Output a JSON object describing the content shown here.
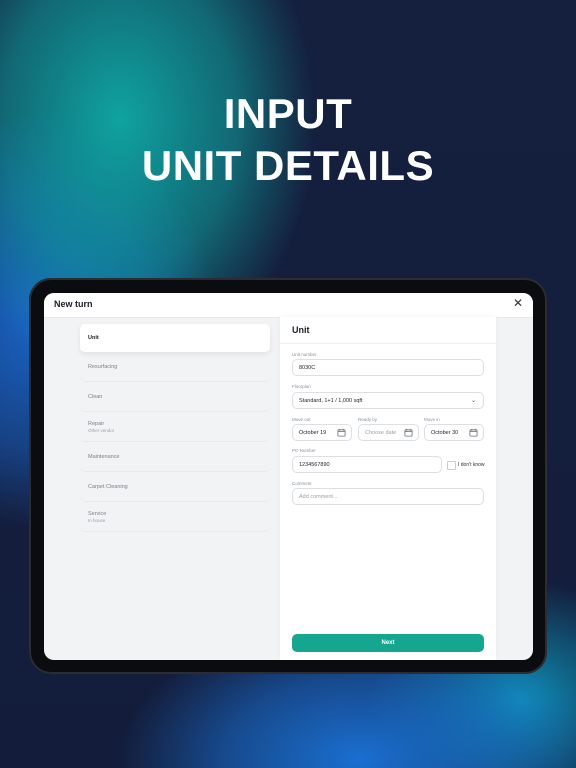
{
  "headline": {
    "line1": "INPUT",
    "line2": "UNIT DETAILS"
  },
  "modal": {
    "title": "New turn",
    "close_icon": "close-icon"
  },
  "sidebar": {
    "items": [
      {
        "label": "Unit",
        "sub": ""
      },
      {
        "label": "Resurfacing",
        "sub": ""
      },
      {
        "label": "Clean",
        "sub": ""
      },
      {
        "label": "Repair",
        "sub": "Other vendor"
      },
      {
        "label": "Maintenance",
        "sub": ""
      },
      {
        "label": "Carpet Cleaning",
        "sub": ""
      },
      {
        "label": "Service",
        "sub": "In house"
      }
    ]
  },
  "form": {
    "title": "Unit",
    "unit_number": {
      "label": "Unit number",
      "value": "8030C"
    },
    "floorplan": {
      "label": "Floorplan",
      "value": "Standard, 1+1 / 1,000 sqft"
    },
    "move_out": {
      "label": "Move out",
      "value": "October 19"
    },
    "ready_by": {
      "label": "Ready by",
      "placeholder": "Choose date"
    },
    "move_in": {
      "label": "Move in",
      "value": "October 30"
    },
    "po_number": {
      "label": "PO Number",
      "value": "1234567890"
    },
    "dont_know": {
      "label": "I don't know"
    },
    "comment": {
      "label": "Comment",
      "placeholder": "Add comment..."
    },
    "next_label": "Next"
  },
  "colors": {
    "accent": "#14a68f",
    "bg_dark": "#15203f",
    "teal": "#0fa3a0"
  }
}
